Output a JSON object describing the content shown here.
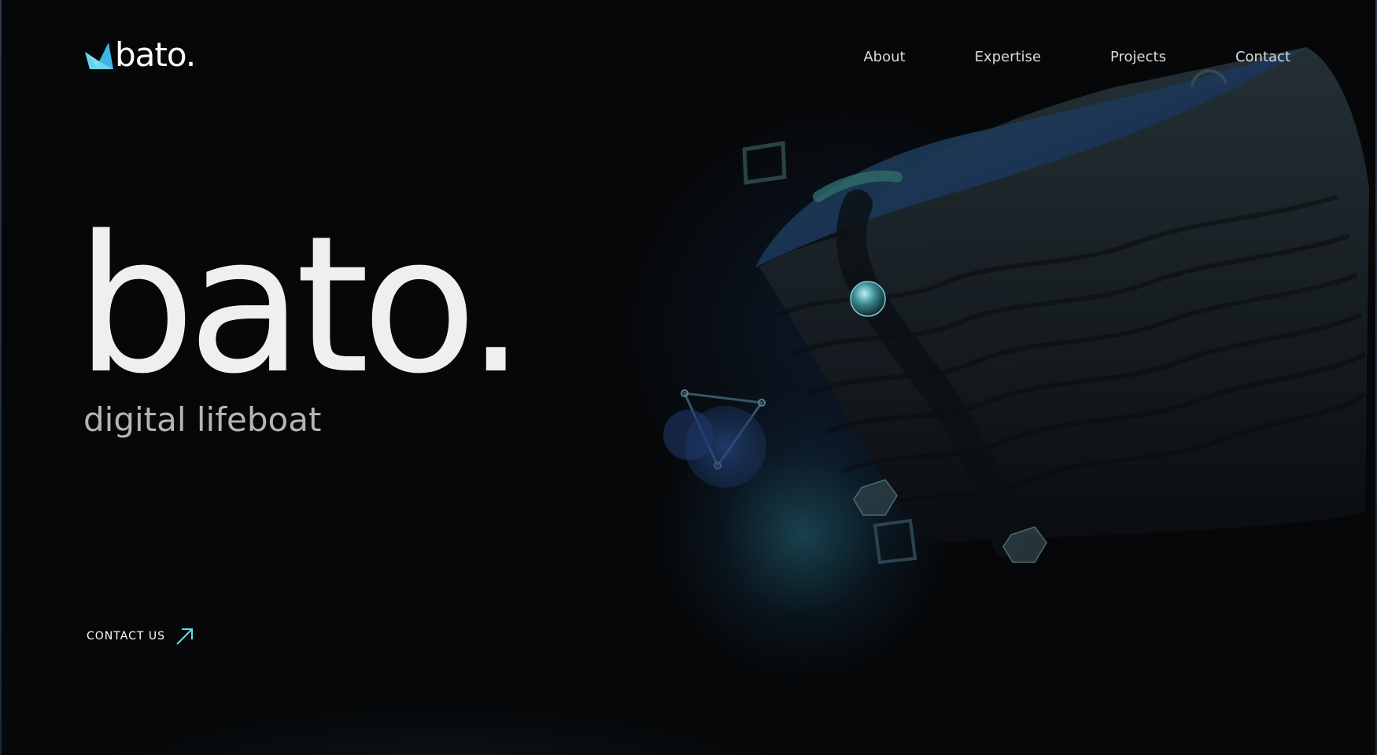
{
  "brand": {
    "name": "bato.",
    "accent_color": "#4fc3e6"
  },
  "nav": {
    "items": [
      {
        "label": "About"
      },
      {
        "label": "Expertise"
      },
      {
        "label": "Projects"
      },
      {
        "label": "Contact"
      }
    ]
  },
  "hero": {
    "title": "bato.",
    "subtitle": "digital lifeboat"
  },
  "cta": {
    "label": "CONTACT US",
    "icon": "arrow-up-right-icon"
  },
  "artwork": {
    "description_icon": "cube-3d-illustration"
  },
  "colors": {
    "background": "#060708",
    "text_primary": "#efefef",
    "text_secondary": "#b3b5b7",
    "glow": "#2a6e82"
  }
}
